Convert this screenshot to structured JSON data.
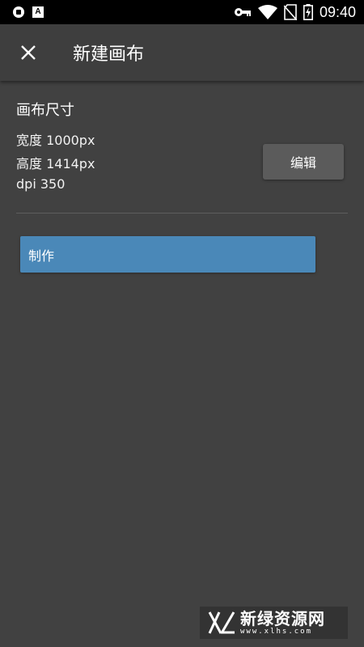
{
  "status_bar": {
    "time": "09:40",
    "icons": [
      "shield-icon",
      "a-badge-icon",
      "key-icon",
      "wifi-icon",
      "no-sim-icon",
      "battery-charging-icon"
    ],
    "a_badge_text": "A"
  },
  "app_bar": {
    "close_icon": "close-icon",
    "title": "新建画布"
  },
  "canvas": {
    "section_title": "画布尺寸",
    "width_line": "宽度 1000px",
    "height_line": "高度 1414px",
    "dpi_line": "dpi 350",
    "edit_label": "编辑"
  },
  "actions": {
    "make_label": "制作"
  },
  "watermark": {
    "text": "新绿资源网",
    "subtext": "www.xlhs.com"
  },
  "colors": {
    "background": "#414141",
    "app_bar": "#3e3e3e",
    "status_bar": "#000000",
    "primary_button": "#4a88b8",
    "secondary_button": "#5b5b5b"
  }
}
